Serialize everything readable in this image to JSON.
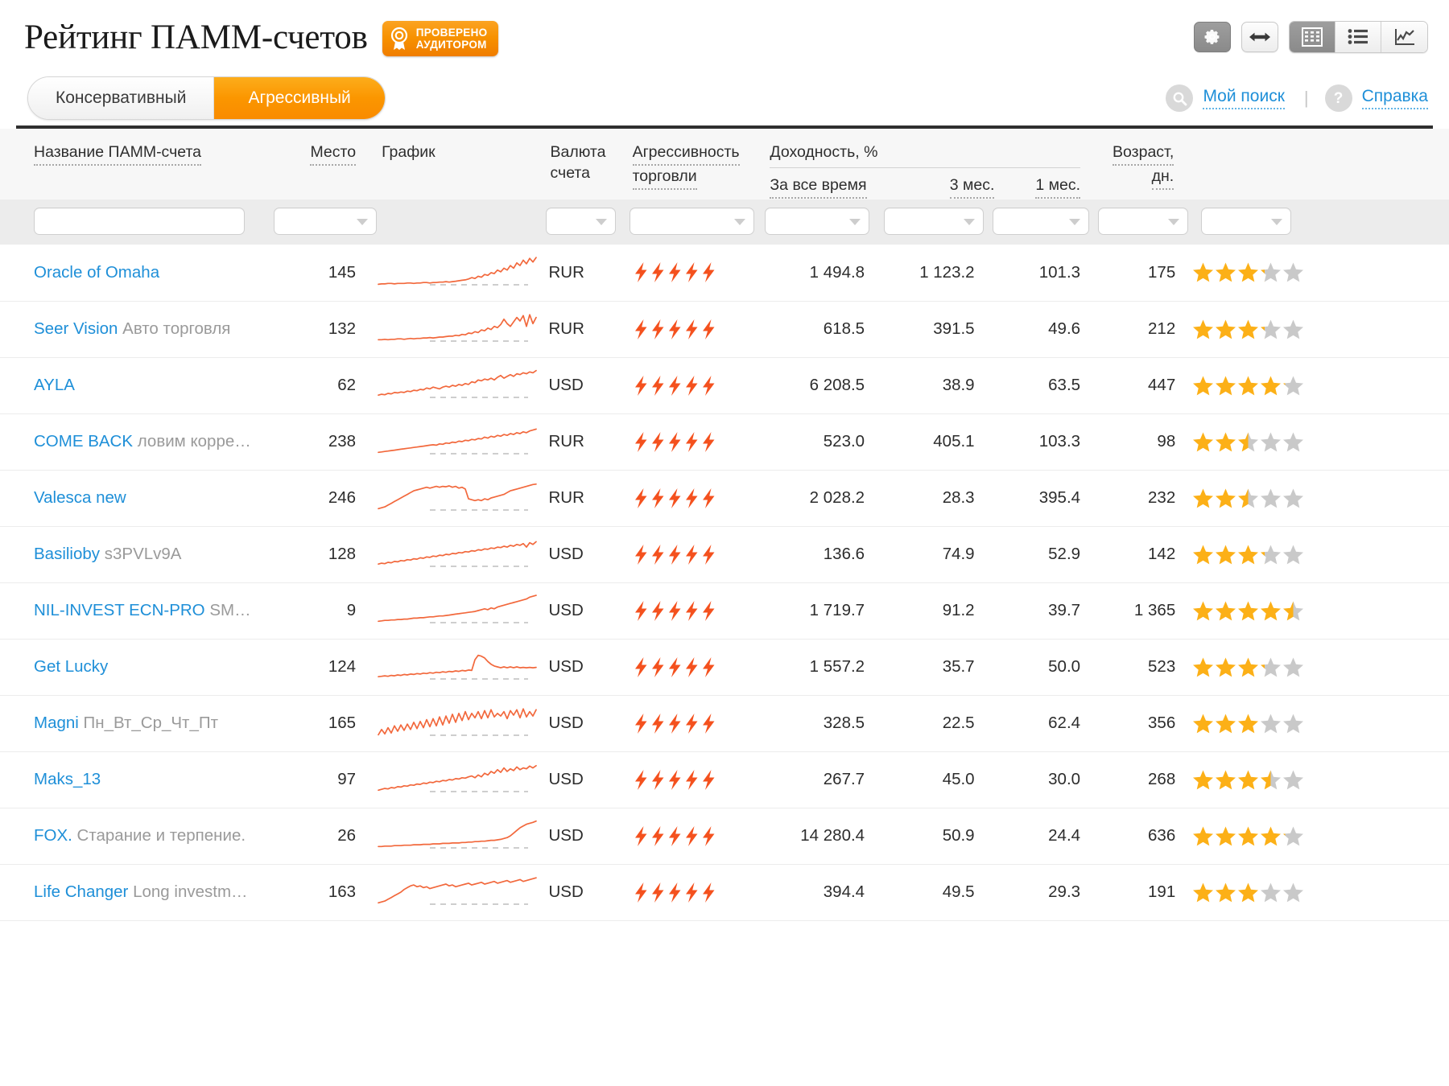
{
  "header": {
    "title": "Рейтинг ПАММ-счетов",
    "badge": {
      "line1": "ПРОВЕРЕНО",
      "line2": "АУДИТОРОМ",
      "icon": "audit-seal-icon"
    },
    "tools": [
      {
        "name": "settings-gear-button",
        "icon": "gear-icon",
        "active": true
      },
      {
        "name": "resize-width-button",
        "icon": "horizontal-arrows-icon",
        "active": false
      }
    ],
    "view_modes": [
      {
        "name": "table-view-button",
        "icon": "grid-table-icon",
        "active": true
      },
      {
        "name": "list-view-button",
        "icon": "bullet-list-icon",
        "active": false
      },
      {
        "name": "chart-view-button",
        "icon": "line-chart-icon",
        "active": false
      }
    ]
  },
  "tabs": [
    {
      "label": "Консервативный",
      "active": false
    },
    {
      "label": "Агрессивный",
      "active": true
    }
  ],
  "links": {
    "search": {
      "label": "Мой поиск",
      "icon": "search-icon"
    },
    "separator": "|",
    "help": {
      "label": "Справка",
      "icon": "question-mark-icon"
    }
  },
  "table": {
    "headers": {
      "name": "Название ПАММ-счета",
      "place": "Место",
      "chart": "График",
      "currency_l1": "Валюта",
      "currency_l2": "счета",
      "aggression_l1": "Агрессивность",
      "aggression_l2": "торговли",
      "yield_group": "Доходность, %",
      "yield_all": "За все время",
      "yield_3m": "3 мес.",
      "yield_1m": "1 мес.",
      "age_l1": "Возраст,",
      "age_l2": "дн."
    },
    "filters": [
      {
        "name": "filter-name-input",
        "type": "text",
        "value": "",
        "placeholder": ""
      },
      {
        "name": "filter-place-select",
        "type": "select",
        "value": ""
      },
      {
        "name": "filter-currency-select",
        "type": "select",
        "value": ""
      },
      {
        "name": "filter-aggression-select",
        "type": "select",
        "value": ""
      },
      {
        "name": "filter-yield-all-select",
        "type": "select",
        "value": ""
      },
      {
        "name": "filter-yield-3m-select",
        "type": "select",
        "value": ""
      },
      {
        "name": "filter-yield-1m-select",
        "type": "select",
        "value": ""
      },
      {
        "name": "filter-age-select",
        "type": "select",
        "value": ""
      },
      {
        "name": "filter-rating-select",
        "type": "select",
        "value": ""
      }
    ],
    "rows": [
      {
        "name": "Oracle of Omaha",
        "sub": "",
        "place": "145",
        "currency": "RUR",
        "bolts": 5,
        "bolts_partial": 1.0,
        "yield_all": "1 494.8",
        "yield_3m": "1 123.2",
        "yield_1m": "101.3",
        "age": "175",
        "stars": 3.2,
        "spark": [
          62,
          61,
          61,
          60,
          60,
          61,
          60,
          60,
          60,
          59,
          59,
          60,
          59,
          59,
          58,
          58,
          59,
          58,
          58,
          57,
          57,
          56,
          57,
          56,
          55,
          54,
          53,
          52,
          50,
          47,
          49,
          44,
          46,
          40,
          42,
          36,
          38,
          30,
          34,
          26,
          30,
          20,
          26,
          14,
          20,
          8,
          16,
          4,
          12,
          2
        ]
      },
      {
        "name": "Seer Vision",
        "sub": "Авто торговля",
        "place": "132",
        "currency": "RUR",
        "bolts": 5,
        "bolts_partial": 1.0,
        "yield_all": "618.5",
        "yield_3m": "391.5",
        "yield_1m": "49.6",
        "age": "212",
        "stars": 3.2,
        "spark": [
          60,
          60,
          59,
          60,
          59,
          59,
          58,
          58,
          59,
          58,
          57,
          58,
          57,
          57,
          56,
          56,
          55,
          56,
          55,
          54,
          54,
          53,
          52,
          52,
          50,
          51,
          48,
          49,
          45,
          46,
          42,
          44,
          38,
          40,
          34,
          37,
          30,
          33,
          26,
          14,
          24,
          30,
          20,
          10,
          18,
          6,
          30,
          4,
          24,
          10
        ]
      },
      {
        "name": "AYLA",
        "sub": "",
        "place": "62",
        "currency": "USD",
        "bolts": 5,
        "bolts_partial": 1.0,
        "yield_all": "6 208.5",
        "yield_3m": "38.9",
        "yield_1m": "63.5",
        "age": "447",
        "stars": 4.1,
        "spark": [
          58,
          56,
          57,
          54,
          55,
          52,
          53,
          51,
          52,
          49,
          50,
          47,
          48,
          45,
          46,
          42,
          44,
          40,
          42,
          44,
          40,
          38,
          40,
          36,
          38,
          34,
          36,
          32,
          34,
          28,
          30,
          24,
          26,
          22,
          24,
          20,
          24,
          18,
          14,
          20,
          16,
          12,
          16,
          10,
          12,
          8,
          10,
          6,
          8,
          3
        ]
      },
      {
        "name": "COME BACK",
        "sub": "ловим корре…",
        "place": "238",
        "currency": "RUR",
        "bolts": 5,
        "bolts_partial": 1.0,
        "yield_all": "523.0",
        "yield_3m": "405.1",
        "yield_1m": "103.3",
        "age": "98",
        "stars": 2.5,
        "spark": [
          60,
          59,
          58,
          57,
          56,
          55,
          54,
          53,
          52,
          51,
          50,
          49,
          48,
          47,
          46,
          45,
          44,
          43,
          44,
          41,
          42,
          39,
          40,
          37,
          38,
          35,
          36,
          33,
          34,
          31,
          32,
          29,
          30,
          26,
          28,
          24,
          26,
          22,
          24,
          20,
          22,
          18,
          20,
          16,
          18,
          14,
          16,
          12,
          10,
          8
        ]
      },
      {
        "name": "Valesca new",
        "sub": "",
        "place": "246",
        "currency": "RUR",
        "bolts": 5,
        "bolts_partial": 1.0,
        "yield_all": "2 028.2",
        "yield_3m": "28.3",
        "yield_1m": "395.4",
        "age": "232",
        "stars": 2.5,
        "spark": [
          60,
          58,
          56,
          52,
          48,
          44,
          40,
          36,
          32,
          28,
          24,
          20,
          18,
          16,
          14,
          12,
          14,
          12,
          10,
          12,
          10,
          11,
          9,
          12,
          10,
          14,
          12,
          16,
          38,
          40,
          42,
          40,
          42,
          38,
          40,
          36,
          34,
          32,
          30,
          28,
          24,
          20,
          18,
          16,
          14,
          12,
          10,
          8,
          6,
          5
        ]
      },
      {
        "name": "Basilioby",
        "sub": "s3PVLv9A",
        "place": "128",
        "currency": "USD",
        "bolts": 5,
        "bolts_partial": 1.0,
        "yield_all": "136.6",
        "yield_3m": "74.9",
        "yield_1m": "52.9",
        "age": "142",
        "stars": 3.2,
        "spark": [
          58,
          56,
          57,
          54,
          55,
          52,
          53,
          50,
          51,
          48,
          49,
          46,
          47,
          44,
          45,
          42,
          43,
          40,
          41,
          38,
          39,
          36,
          37,
          34,
          35,
          32,
          33,
          30,
          31,
          28,
          29,
          26,
          27,
          24,
          25,
          22,
          23,
          20,
          21,
          18,
          20,
          16,
          18,
          14,
          16,
          12,
          20,
          10,
          14,
          8
        ]
      },
      {
        "name": "NIL-INVEST ECN-PRO",
        "sub": "SM…",
        "place": "9",
        "currency": "USD",
        "bolts": 5,
        "bolts_partial": 0.5,
        "yield_all": "1 719.7",
        "yield_3m": "91.2",
        "yield_1m": "39.7",
        "age": "1 365",
        "stars": 4.5,
        "spark": [
          60,
          59,
          58,
          58,
          57,
          57,
          56,
          56,
          55,
          55,
          54,
          53,
          53,
          52,
          52,
          51,
          50,
          50,
          49,
          48,
          48,
          47,
          46,
          45,
          44,
          43,
          42,
          41,
          40,
          39,
          38,
          36,
          34,
          32,
          34,
          30,
          32,
          28,
          26,
          24,
          22,
          20,
          18,
          16,
          14,
          12,
          10,
          6,
          4,
          2
        ]
      },
      {
        "name": "Get Lucky",
        "sub": "",
        "place": "124",
        "currency": "USD",
        "bolts": 5,
        "bolts_partial": 1.0,
        "yield_all": "1 557.2",
        "yield_3m": "35.7",
        "yield_1m": "50.0",
        "age": "523",
        "stars": 3.2,
        "spark": [
          58,
          57,
          56,
          57,
          55,
          56,
          54,
          55,
          53,
          54,
          52,
          53,
          51,
          52,
          50,
          51,
          49,
          50,
          48,
          49,
          47,
          48,
          46,
          47,
          45,
          46,
          44,
          45,
          43,
          44,
          20,
          10,
          12,
          16,
          24,
          30,
          34,
          36,
          38,
          36,
          38,
          36,
          38,
          36,
          38,
          37,
          38,
          37,
          38,
          37
        ]
      },
      {
        "name": "Magni",
        "sub": "Пн_Вт_Ср_Чт_Пт",
        "place": "165",
        "currency": "USD",
        "bolts": 5,
        "bolts_partial": 1.0,
        "yield_all": "328.5",
        "yield_3m": "22.5",
        "yield_1m": "62.4",
        "age": "356",
        "stars": 3.0,
        "spark": [
          62,
          50,
          60,
          46,
          58,
          42,
          54,
          40,
          52,
          38,
          50,
          34,
          48,
          32,
          46,
          28,
          44,
          26,
          42,
          22,
          40,
          20,
          36,
          16,
          34,
          14,
          30,
          10,
          28,
          14,
          24,
          10,
          26,
          8,
          24,
          6,
          22,
          14,
          20,
          10,
          26,
          8,
          18,
          6,
          24,
          4,
          22,
          10,
          20,
          6
        ]
      },
      {
        "name": "Maks_13",
        "sub": "",
        "place": "97",
        "currency": "USD",
        "bolts": 5,
        "bolts_partial": 1.0,
        "yield_all": "267.7",
        "yield_3m": "45.0",
        "yield_1m": "30.0",
        "age": "268",
        "stars": 3.5,
        "spark": [
          60,
          58,
          56,
          57,
          54,
          55,
          52,
          53,
          50,
          51,
          48,
          49,
          46,
          47,
          44,
          45,
          42,
          43,
          40,
          41,
          38,
          39,
          36,
          37,
          34,
          35,
          32,
          33,
          30,
          28,
          32,
          26,
          30,
          22,
          26,
          18,
          22,
          14,
          20,
          10,
          18,
          12,
          16,
          8,
          14,
          10,
          12,
          6,
          10,
          5
        ]
      },
      {
        "name": "FOX.",
        "sub": "Старание и терпение.",
        "place": "26",
        "currency": "USD",
        "bolts": 5,
        "bolts_partial": 1.0,
        "yield_all": "14 280.4",
        "yield_3m": "50.9",
        "yield_1m": "24.4",
        "age": "636",
        "stars": 4.1,
        "spark": [
          60,
          60,
          59,
          59,
          59,
          58,
          58,
          58,
          57,
          57,
          57,
          56,
          56,
          56,
          55,
          55,
          55,
          54,
          54,
          54,
          53,
          53,
          53,
          52,
          52,
          52,
          51,
          51,
          50,
          50,
          49,
          49,
          48,
          48,
          47,
          46,
          46,
          45,
          44,
          42,
          40,
          36,
          30,
          24,
          18,
          14,
          10,
          8,
          6,
          3
        ]
      },
      {
        "name": "Life Changer",
        "sub": "Long investm…",
        "place": "163",
        "currency": "USD",
        "bolts": 5,
        "bolts_partial": 1.0,
        "yield_all": "394.4",
        "yield_3m": "49.5",
        "yield_1m": "29.3",
        "age": "191",
        "stars": 3.0,
        "spark": [
          60,
          58,
          56,
          52,
          48,
          44,
          40,
          36,
          30,
          26,
          22,
          20,
          24,
          22,
          26,
          24,
          28,
          26,
          24,
          22,
          20,
          18,
          22,
          20,
          24,
          22,
          20,
          18,
          16,
          20,
          18,
          16,
          14,
          18,
          16,
          14,
          12,
          16,
          14,
          12,
          10,
          14,
          12,
          10,
          8,
          12,
          10,
          8,
          6,
          4
        ]
      }
    ]
  },
  "colors": {
    "accent_orange": "#f99000",
    "link_blue": "#1e8fd8",
    "spark_line": "#f2683c",
    "bolt_active": "#f4511e",
    "bolt_inactive": "#d2d2d2",
    "star_active": "#fcb017",
    "star_inactive": "#c9c9c9"
  }
}
